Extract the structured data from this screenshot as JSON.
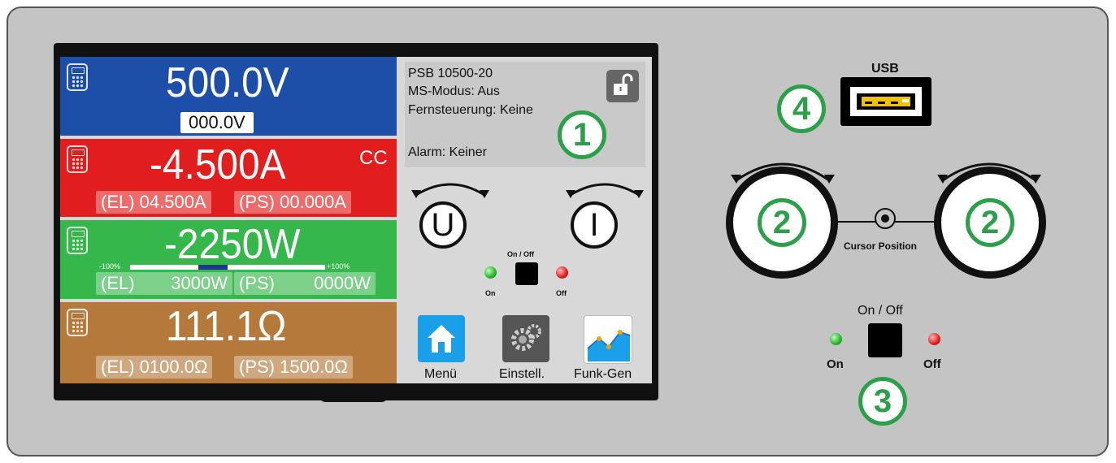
{
  "screen": {
    "voltage": {
      "actual": "500.0V",
      "set": "000.0V"
    },
    "current": {
      "actual": "-4.500A",
      "mode": "CC",
      "el": "(EL) 04.500A",
      "ps": "(PS) 00.000A"
    },
    "power": {
      "actual": "-2250W",
      "scale_min": "-100%",
      "scale_max": "+100%",
      "el_label": "(EL)",
      "el_value": "3000W",
      "ps_label": "(PS)",
      "ps_value": "0000W",
      "bar_level_percent": -30
    },
    "resistance": {
      "actual": "111.1Ω",
      "el": "(EL) 0100.0Ω",
      "ps": "(PS) 1500.0Ω"
    },
    "info": {
      "model": "PSB 10500-20",
      "ms_mode": "MS-Modus: Aus",
      "remote": "Fernsteuerung: Keine",
      "alarm": "Alarm: Keiner"
    },
    "knob_u": "U",
    "knob_i": "I",
    "onoff_label": "On / Off",
    "on_label": "On",
    "off_label": "Off",
    "apps": [
      {
        "label": "Menü",
        "icon": "home-icon"
      },
      {
        "label": "Einstell.",
        "icon": "gears-icon"
      },
      {
        "label": "Funk-Gen",
        "icon": "chart-icon"
      }
    ]
  },
  "panel": {
    "usb_label": "USB",
    "cursor_label": "Cursor Position",
    "onoff_label": "On / Off",
    "on_label": "On",
    "off_label": "Off",
    "callouts": [
      "1",
      "2",
      "2",
      "3",
      "4"
    ]
  },
  "colors": {
    "voltage": "#1d4fa8",
    "current": "#e21d1d",
    "power": "#36b74b",
    "resistance": "#b57a3b",
    "callout": "#2aa048"
  }
}
